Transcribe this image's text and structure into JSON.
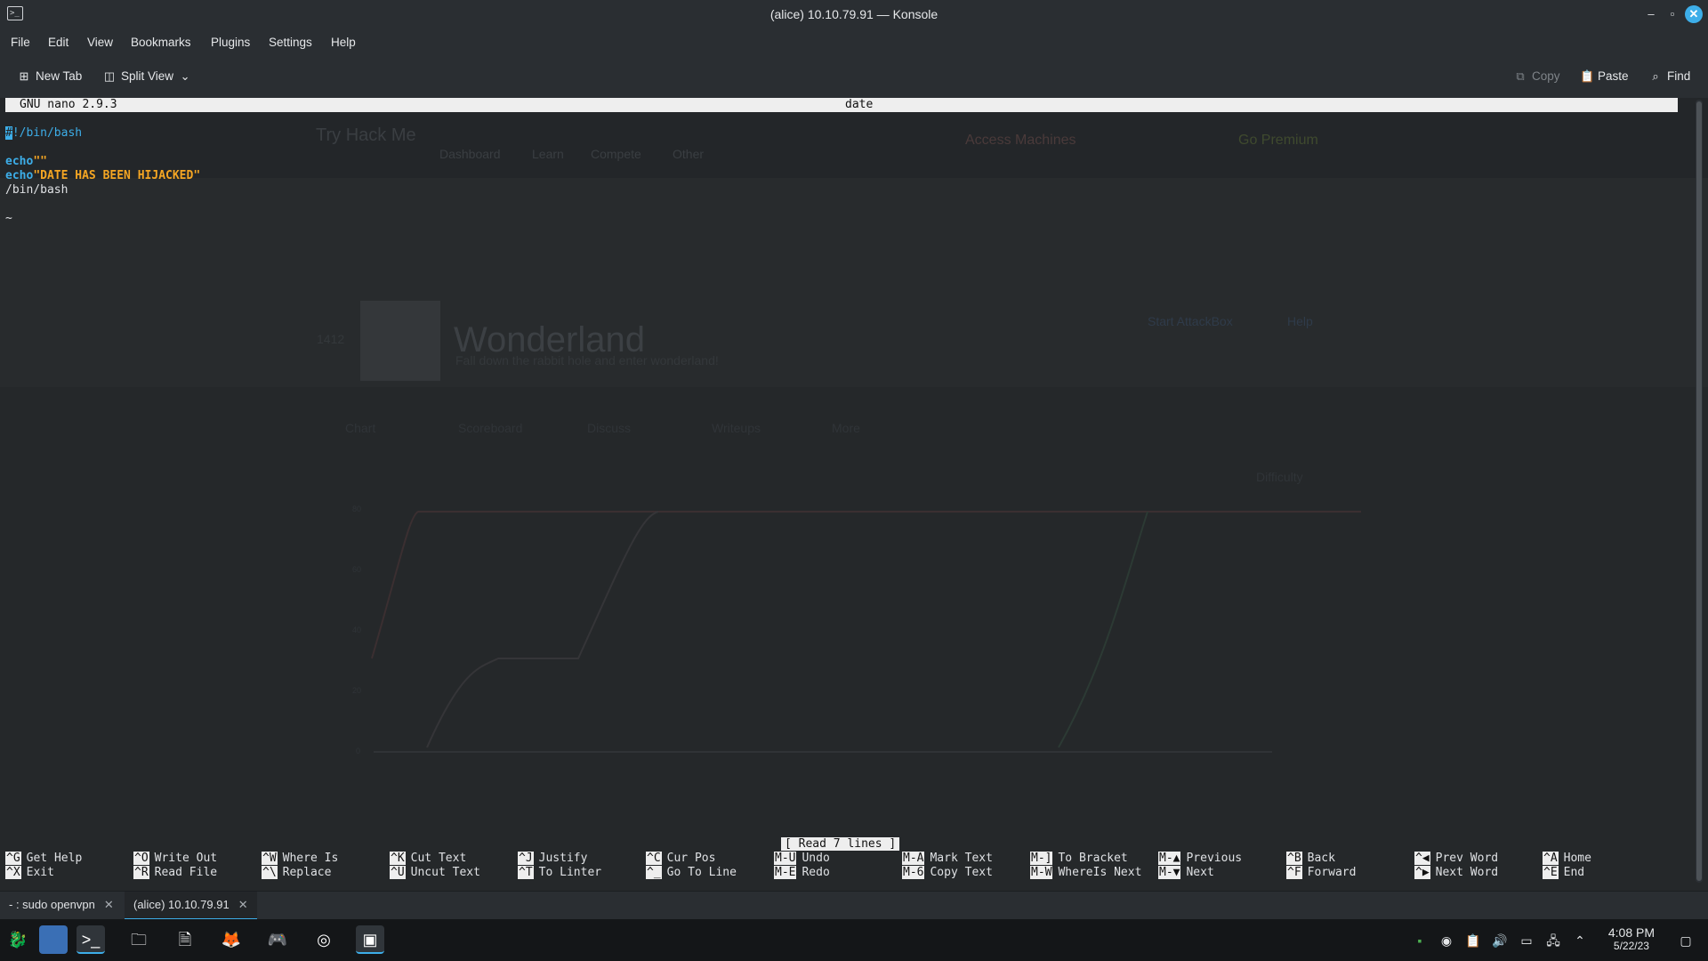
{
  "window": {
    "title": "(alice) 10.10.79.91 — Konsole"
  },
  "menu": [
    "File",
    "Edit",
    "View",
    "Bookmarks",
    "Plugins",
    "Settings",
    "Help"
  ],
  "toolbar": {
    "new_tab": "New Tab",
    "split_view": "Split View",
    "copy": "Copy",
    "paste": "Paste",
    "find": "Find"
  },
  "nano": {
    "version": "GNU nano 2.9.3",
    "filename": "date",
    "shebang_rest": "!/bin/bash",
    "shebang_first": "#",
    "line3_kw": "echo",
    "line3_str": "\"\"",
    "line4_kw": "echo",
    "line4_str": "\"DATE HAS BEEN HIJACKED\"",
    "line5": "/bin/bash",
    "tilde": "~",
    "status": "[ Read 7 lines ]",
    "shortcuts": [
      {
        "k1": "^G",
        "l1": "Get Help",
        "k2": "^X",
        "l2": "Exit"
      },
      {
        "k1": "^O",
        "l1": "Write Out",
        "k2": "^R",
        "l2": "Read File"
      },
      {
        "k1": "^W",
        "l1": "Where Is",
        "k2": "^\\",
        "l2": "Replace"
      },
      {
        "k1": "^K",
        "l1": "Cut Text",
        "k2": "^U",
        "l2": "Uncut Text"
      },
      {
        "k1": "^J",
        "l1": "Justify",
        "k2": "^T",
        "l2": "To Linter"
      },
      {
        "k1": "^C",
        "l1": "Cur Pos",
        "k2": "^_",
        "l2": "Go To Line"
      },
      {
        "k1": "M-U",
        "l1": "Undo",
        "k2": "M-E",
        "l2": "Redo"
      },
      {
        "k1": "M-A",
        "l1": "Mark Text",
        "k2": "M-6",
        "l2": "Copy Text"
      },
      {
        "k1": "M-]",
        "l1": "To Bracket",
        "k2": "M-W",
        "l2": "WhereIs Next"
      },
      {
        "k1": "M-▲",
        "l1": "Previous",
        "k2": "M-▼",
        "l2": "Next"
      },
      {
        "k1": "^B",
        "l1": "Back",
        "k2": "^F",
        "l2": "Forward"
      },
      {
        "k1": "^◀",
        "l1": "Prev Word",
        "k2": "^▶",
        "l2": "Next Word"
      },
      {
        "k1": "^A",
        "l1": "Home",
        "k2": "^E",
        "l2": "End"
      }
    ]
  },
  "background_page": {
    "brand": "Try Hack Me",
    "nav": [
      "Dashboard",
      "Learn",
      "Compete",
      "Other"
    ],
    "access": "Access Machines",
    "premium": "Go Premium",
    "room_title": "Wonderland",
    "room_subtitle": "Fall down the rabbit hole and enter wonderland!",
    "votes": "1412",
    "attackbox": "Start AttackBox",
    "help": "Help",
    "tabs": [
      "Chart",
      "Scoreboard",
      "Discuss",
      "Writeups",
      "More"
    ],
    "difficulty": "Difficulty",
    "y_ticks": [
      "80",
      "60",
      "40",
      "20",
      "0"
    ]
  },
  "tabs": [
    {
      "label": "- : sudo openvpn",
      "active": false
    },
    {
      "label": "(alice) 10.10.79.91",
      "active": true
    }
  ],
  "clock": {
    "time": "4:08 PM",
    "date": "5/22/23"
  },
  "colors": {
    "accent": "#3daee9",
    "keyword": "#3daee9",
    "string": "#f5a623"
  }
}
